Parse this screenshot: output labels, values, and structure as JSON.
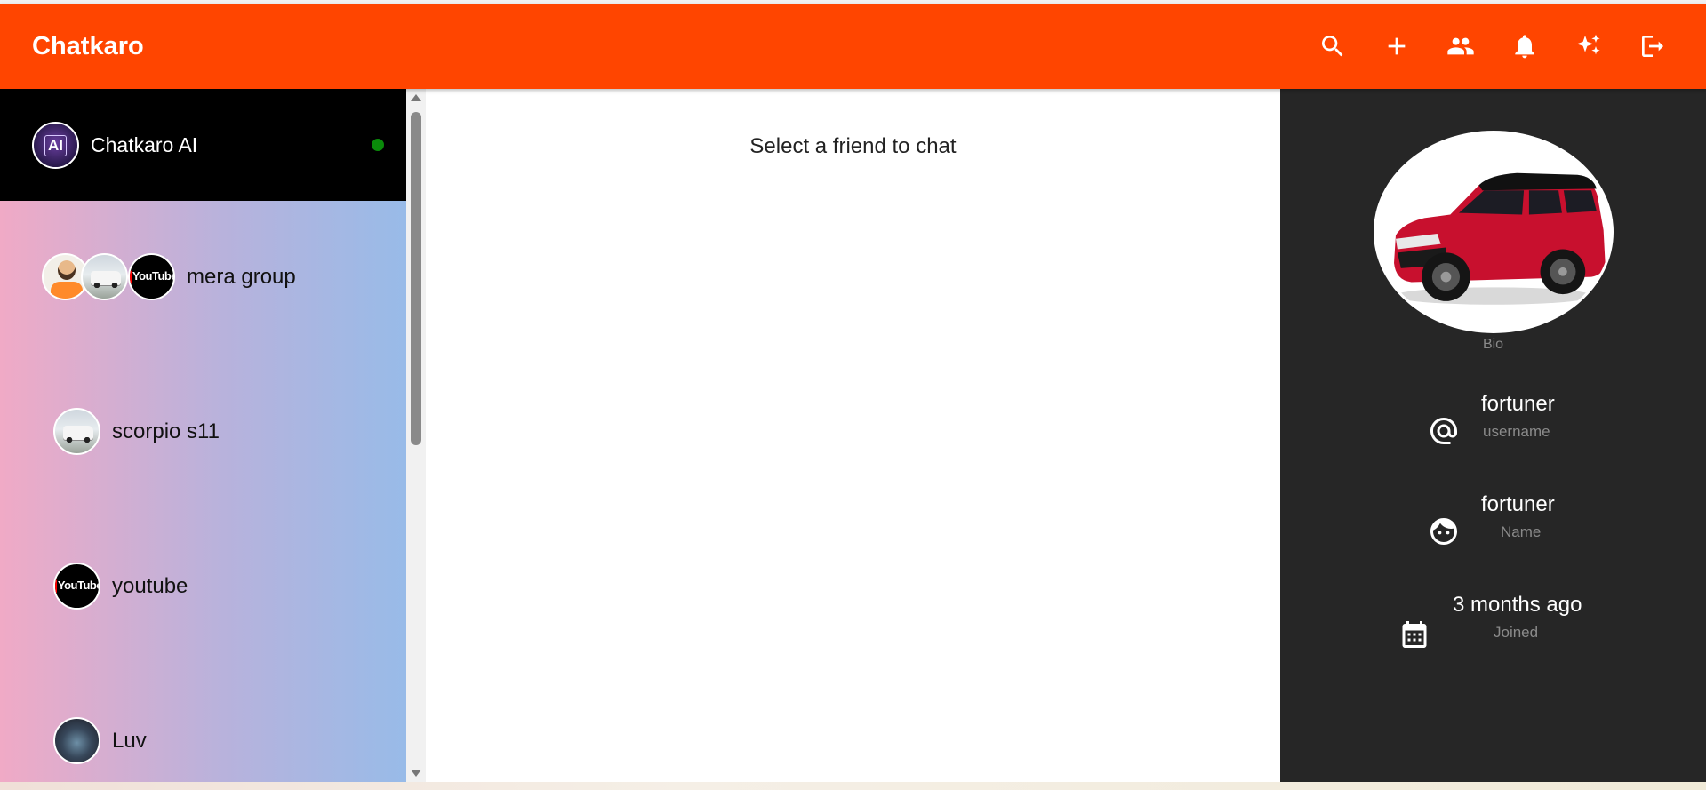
{
  "header": {
    "title": "Chatkaro",
    "actions": [
      {
        "icon": "search-icon"
      },
      {
        "icon": "add-icon"
      },
      {
        "icon": "people-icon"
      },
      {
        "icon": "bell-icon"
      },
      {
        "icon": "sparkle-icon"
      },
      {
        "icon": "logout-icon"
      }
    ],
    "bg_color": "#ff4500"
  },
  "sidebar": {
    "ai_chat": {
      "name": "Chatkaro AI",
      "avatar_text": "AI",
      "status": "online",
      "status_color": "#0a8a0a"
    },
    "friends": [
      {
        "name": "mera group",
        "type": "group",
        "avatars": [
          "coder-avatar",
          "car-avatar",
          "youtube-avatar"
        ]
      },
      {
        "name": "scorpio s11",
        "avatars": [
          "car-avatar"
        ]
      },
      {
        "name": "youtube",
        "avatars": [
          "youtube-avatar"
        ]
      },
      {
        "name": "Luv",
        "avatars": [
          "luv-avatar"
        ]
      }
    ],
    "youtube_avatar_text": "YouTube"
  },
  "chat": {
    "placeholder": "Select a friend to chat"
  },
  "profile": {
    "display_name": "fortuner",
    "bio_label": "Bio",
    "details": [
      {
        "icon": "at-icon",
        "value": "fortuner",
        "label": "username"
      },
      {
        "icon": "face-icon",
        "value": "fortuner",
        "label": "Name"
      },
      {
        "icon": "calendar-icon",
        "value": "3 months ago",
        "label": "Joined"
      }
    ],
    "bg_color": "#262626"
  }
}
